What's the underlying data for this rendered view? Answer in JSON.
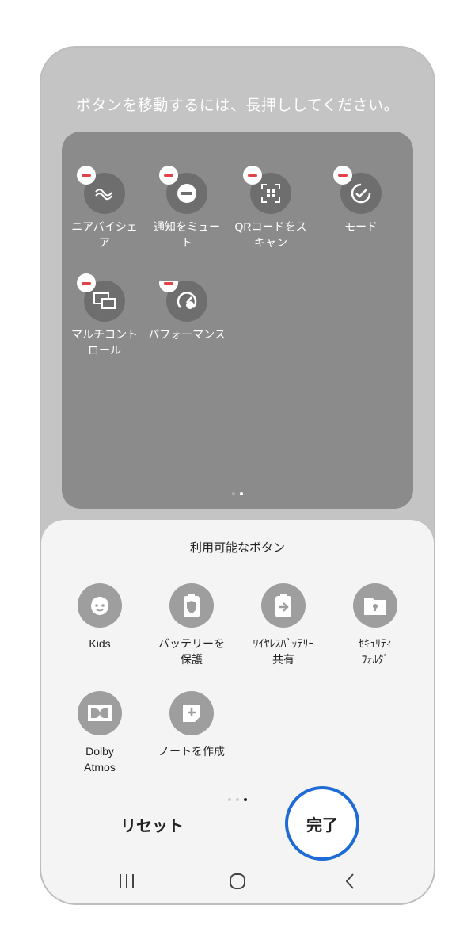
{
  "header": {
    "instruction": "ボタンを移動するには、長押ししてください。"
  },
  "active_panel": {
    "tiles": [
      {
        "label": "ニアバイシェ\nア",
        "icon": "nearby-share-icon"
      },
      {
        "label": "通知をミュー\nト",
        "icon": "mute-notifications-icon"
      },
      {
        "label": "QRコードをス\nキャン",
        "icon": "qr-scan-icon"
      },
      {
        "label": "モード",
        "icon": "modes-icon"
      },
      {
        "label": "マルチコント\nロール",
        "icon": "multi-control-icon"
      },
      {
        "label": "パフォーマンス",
        "icon": "performance-icon"
      }
    ],
    "page_indicator": {
      "pages": 2,
      "current": 2
    }
  },
  "available": {
    "title": "利用可能なボタン",
    "buttons": [
      {
        "label": "Kids",
        "icon": "kids-icon"
      },
      {
        "label": "バッテリーを\n保護",
        "icon": "battery-protect-icon"
      },
      {
        "label": "ﾜｲﾔﾚｽﾊﾞｯﾃﾘｰ\n共有",
        "icon": "wireless-battery-share-icon"
      },
      {
        "label": "ｾｷｭﾘﾃｨ\nﾌｫﾙﾀﾞ",
        "icon": "secure-folder-icon"
      },
      {
        "label": "Dolby\nAtmos",
        "icon": "dolby-atmos-icon"
      },
      {
        "label": "ノートを作成",
        "icon": "create-note-icon"
      }
    ],
    "page_indicator": {
      "pages": 3,
      "current": 3
    }
  },
  "actions": {
    "reset_label": "リセット",
    "done_label": "完了"
  },
  "colors": {
    "accent": "#1f6bd6",
    "minus_badge": "#e0434a"
  },
  "navigation": [
    "recent-apps-icon",
    "home-icon",
    "back-icon"
  ]
}
